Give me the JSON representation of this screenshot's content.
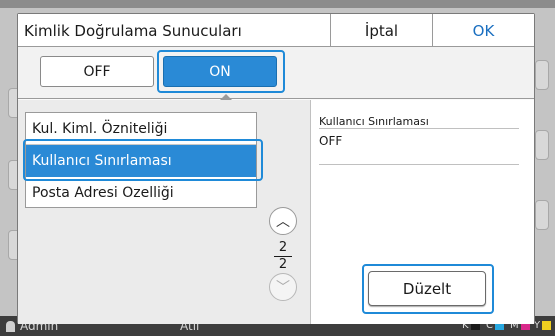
{
  "dialog": {
    "title": "Kimlik Doğrulama Sunucuları",
    "cancel_label": "İptal",
    "ok_label": "OK"
  },
  "toggle": {
    "off_label": "OFF",
    "on_label": "ON",
    "selected": "ON"
  },
  "list": {
    "items": [
      {
        "label": "Kul. Kiml. Özniteliği"
      },
      {
        "label": "Kullanıcı Sınırlaması"
      },
      {
        "label": "Posta Adresi Ozelliği"
      }
    ],
    "selected_index": 1
  },
  "pager": {
    "current": "2",
    "total": "2"
  },
  "detail": {
    "label": "Kullanıcı Sınırlaması",
    "value": "OFF",
    "edit_label": "Düzelt"
  },
  "status_bar": {
    "user": "Admin",
    "mode": "Atıl",
    "ink_labels": [
      "K",
      "C",
      "M",
      "Y"
    ],
    "ink_colors": [
      "#1a1a1a",
      "#28a8e0",
      "#d8288a",
      "#f0d020"
    ]
  },
  "colors": {
    "accent": "#2a8ad6",
    "focus_frame": "#1f8ad8",
    "ok_text": "#1a6fc0"
  }
}
